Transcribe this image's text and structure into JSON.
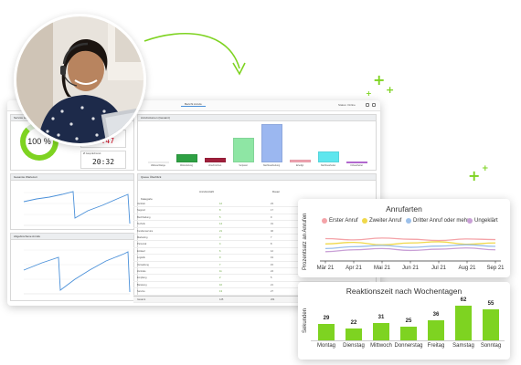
{
  "colors": {
    "accent": "#7ed321",
    "timer_red": "#d0021b",
    "line_blue": "#4a90d9"
  },
  "dashboard": {
    "tab_label": "Bericht Anrufe",
    "user_label": "Status: Online",
    "service_level": {
      "title": "Service Level",
      "value": "100 %",
      "fraction": 0.88
    },
    "waiting_time": {
      "title": "Längste Wartezeit",
      "value": "07:47"
    },
    "avg_time": {
      "title": "Ø Gesprächszeit",
      "value": "20:32"
    },
    "call_volume_title": "Anrufvolumen (Gesamt)",
    "calls_title": "Gesamte Wartezeit",
    "answered_title": "Abgebrochene Anrufe",
    "queue_title": "Queue Überblick",
    "bars": [
      {
        "label": "Warteschlange",
        "value": 0,
        "color": "#ffffff"
      },
      {
        "label": "Weiterleitung",
        "value": 22,
        "color": "#2ea043"
      },
      {
        "label": "Unterbrochen",
        "value": 12,
        "color": "#a0203c"
      },
      {
        "label": "Verpasst",
        "value": 65,
        "color": "#8ee6a4"
      },
      {
        "label": "Nachbearbeitung",
        "value": 100,
        "color": "#9bb7f0"
      },
      {
        "label": "Erledigt",
        "value": 6,
        "color": "#f5a6b4"
      },
      {
        "label": "Nachbearbeitet",
        "value": 28,
        "color": "#5ee6ee"
      },
      {
        "label": "Unbearbeitet",
        "value": 2,
        "color": "#c070e0"
      }
    ],
    "table": {
      "header_a": "Kategorie",
      "header_b": "Anrufanzahl",
      "header_c": "Dauer",
      "rows": [
        {
          "name": "Vertrieb",
          "a": "12",
          "b": "23"
        },
        {
          "name": "Support",
          "a": "8",
          "b": "17"
        },
        {
          "name": "Buchhaltung",
          "a": "5",
          "b": "9"
        },
        {
          "name": "Technik",
          "a": "14",
          "b": "31"
        },
        {
          "name": "Kundenservice",
          "a": "21",
          "b": "46"
        },
        {
          "name": "Marketing",
          "a": "3",
          "b": "7"
        },
        {
          "name": "Personal",
          "a": "4",
          "b": "8"
        },
        {
          "name": "Einkauf",
          "a": "6",
          "b": "12"
        },
        {
          "name": "Logistik",
          "a": "9",
          "b": "19"
        },
        {
          "name": "Verwaltung",
          "a": "7",
          "b": "15"
        },
        {
          "name": "Zentrale",
          "a": "11",
          "b": "24"
        },
        {
          "name": "Empfang",
          "a": "2",
          "b": "5"
        },
        {
          "name": "Beratung",
          "a": "10",
          "b": "21"
        },
        {
          "name": "Service",
          "a": "13",
          "b": "27"
        }
      ],
      "total_label": "Gesamt",
      "total_a": "125",
      "total_b": "264"
    }
  },
  "chart_data": [
    {
      "type": "line",
      "title": "Anrufarten",
      "ylabel": "Prozentsatz an Anrufen",
      "x": [
        "Mär 21",
        "Apr 21",
        "Mai 21",
        "Jun 21",
        "Jul 21",
        "Aug 21",
        "Sep 21"
      ],
      "series": [
        {
          "name": "Erster Anruf",
          "color": "#f4a3a8",
          "values": [
            72,
            68,
            74,
            70,
            66,
            71,
            69
          ]
        },
        {
          "name": "Zweiter Anruf",
          "color": "#f0d84a",
          "values": [
            55,
            60,
            52,
            58,
            62,
            54,
            58
          ]
        },
        {
          "name": "Dritter Anruf oder mehr",
          "color": "#9cc0ea",
          "values": [
            40,
            46,
            50,
            44,
            48,
            52,
            47
          ]
        },
        {
          "name": "Ungeklärt",
          "color": "#c9a0d6",
          "values": [
            30,
            36,
            40,
            34,
            38,
            42,
            36
          ]
        }
      ],
      "ylim": [
        0,
        100
      ]
    },
    {
      "type": "bar",
      "title": "Reaktionszeit nach Wochentagen",
      "ylabel": "Sekunden",
      "categories": [
        "Montag",
        "Dienstag",
        "Mittwoch",
        "Donnerstag",
        "Freitag",
        "Samstag",
        "Sonntag"
      ],
      "values": [
        29,
        22,
        31,
        25,
        36,
        62,
        55
      ],
      "color": "#7ed321",
      "ylim": [
        0,
        62
      ]
    }
  ]
}
